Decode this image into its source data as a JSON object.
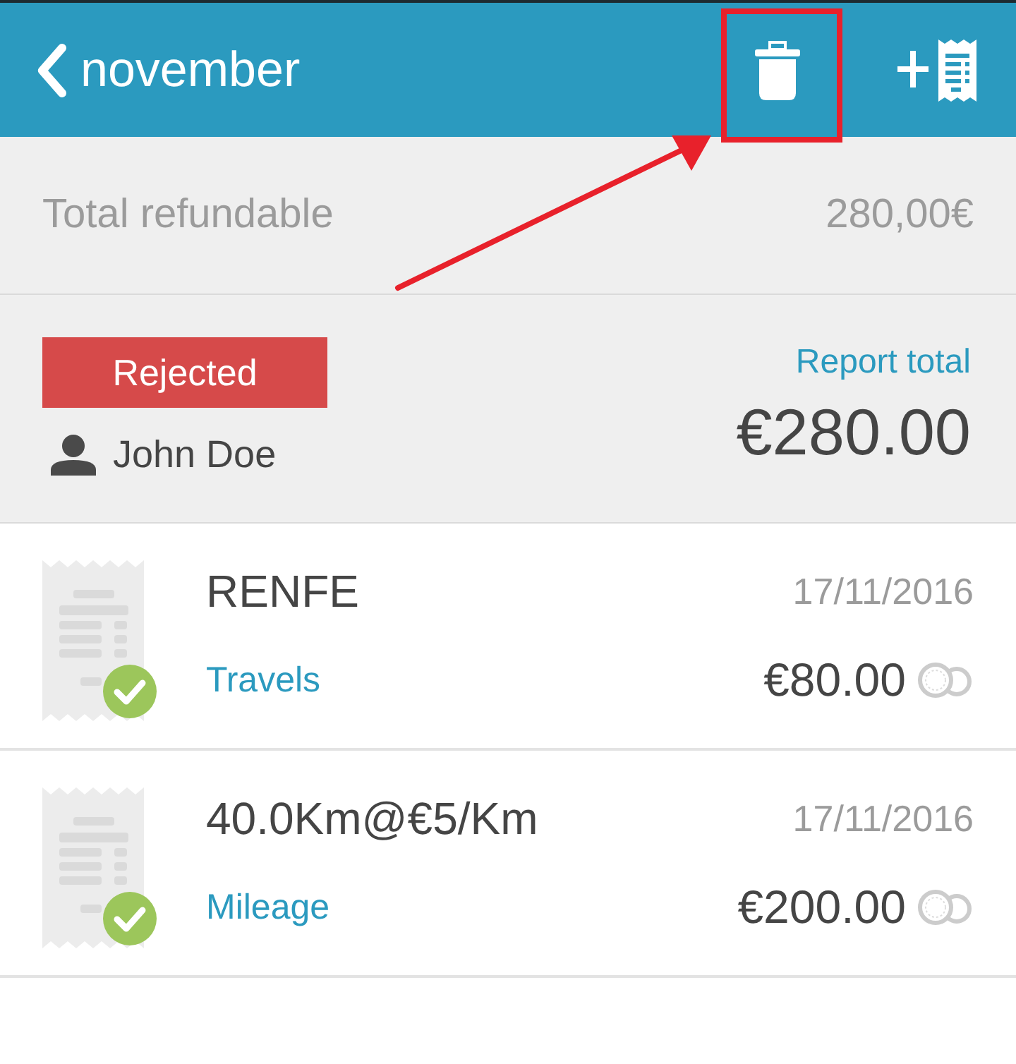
{
  "header": {
    "title": "november"
  },
  "summary": {
    "label": "Total refundable",
    "value": "280,00€"
  },
  "report": {
    "status": {
      "label": "Rejected",
      "kind": "rejected"
    },
    "owner": "John Doe",
    "total_label": "Report total",
    "total": "€280.00"
  },
  "expenses": [
    {
      "title": "RENFE",
      "date": "17/11/2016",
      "category": "Travels",
      "amount": "€80.00",
      "checked": true
    },
    {
      "title": "40.0Km@€5/Km",
      "date": "17/11/2016",
      "category": "Mileage",
      "amount": "€200.00",
      "checked": true
    }
  ]
}
